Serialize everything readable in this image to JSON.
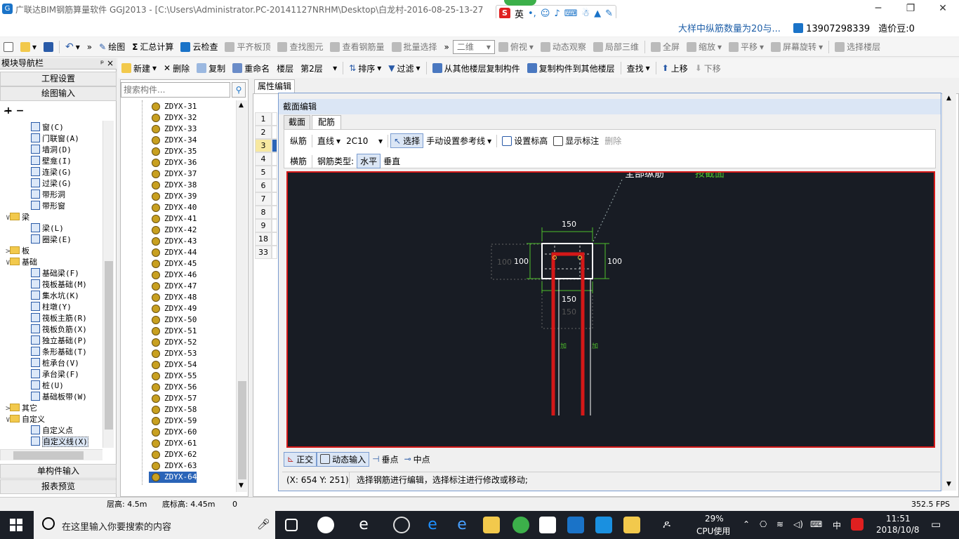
{
  "window": {
    "title": "广联达BIM钢筋算量软件 GGJ2013 - [C:\\Users\\Administrator.PC-20141127NRHM\\Desktop\\白龙村-2016-08-25-13-27",
    "ime_lang": "英",
    "notice": "大样中纵筋数量为20与...",
    "phone": "13907298339",
    "beans": "造价豆:0"
  },
  "toolbar1": {
    "draw": "绘图",
    "sum": "汇总计算",
    "cloud": "云检查",
    "flat": "平齐板顶",
    "find": "查找图元",
    "view_rebar": "查看钢筋量",
    "batch": "批量选择",
    "dim": "二维",
    "top_view": "俯视",
    "dynamic": "动态观察",
    "local3d": "局部三维",
    "full": "全屏",
    "zoom": "缩放",
    "pan": "平移",
    "rotate": "屏幕旋转",
    "floor_sel": "选择楼层"
  },
  "toolbar2": {
    "new": "新建",
    "delete": "删除",
    "copy": "复制",
    "rename": "重命名",
    "floor_label": "楼层",
    "floor_value": "第2层",
    "sort": "排序",
    "filter": "过滤",
    "copy_from": "从其他楼层复制构件",
    "copy_to": "复制构件到其他楼层",
    "find": "查找",
    "up": "上移",
    "down": "下移"
  },
  "left_panel": {
    "header": "模块导航栏",
    "pin": "ᵖ ×",
    "btn_project": "工程设置",
    "btn_draw": "绘图输入",
    "btn_single": "单构件输入",
    "btn_report": "报表预览",
    "tree": [
      {
        "label": "窗(C)",
        "indent": 3,
        "type": "item"
      },
      {
        "label": "门联窗(A)",
        "indent": 3,
        "type": "item"
      },
      {
        "label": "墙洞(D)",
        "indent": 3,
        "type": "item"
      },
      {
        "label": "壁龛(I)",
        "indent": 3,
        "type": "item"
      },
      {
        "label": "连梁(G)",
        "indent": 3,
        "type": "item"
      },
      {
        "label": "过梁(G)",
        "indent": 3,
        "type": "item"
      },
      {
        "label": "带形洞",
        "indent": 3,
        "type": "item"
      },
      {
        "label": "带形窗",
        "indent": 3,
        "type": "item"
      },
      {
        "label": "梁",
        "indent": 1,
        "type": "folder",
        "exp": "∨"
      },
      {
        "label": "梁(L)",
        "indent": 3,
        "type": "item"
      },
      {
        "label": "圈梁(E)",
        "indent": 3,
        "type": "item"
      },
      {
        "label": "板",
        "indent": 1,
        "type": "folder",
        "exp": ">"
      },
      {
        "label": "基础",
        "indent": 1,
        "type": "folder",
        "exp": "∨"
      },
      {
        "label": "基础梁(F)",
        "indent": 3,
        "type": "item"
      },
      {
        "label": "筏板基础(M)",
        "indent": 3,
        "type": "item"
      },
      {
        "label": "集水坑(K)",
        "indent": 3,
        "type": "item"
      },
      {
        "label": "柱墩(Y)",
        "indent": 3,
        "type": "item"
      },
      {
        "label": "筏板主筋(R)",
        "indent": 3,
        "type": "item"
      },
      {
        "label": "筏板负筋(X)",
        "indent": 3,
        "type": "item"
      },
      {
        "label": "独立基础(P)",
        "indent": 3,
        "type": "item"
      },
      {
        "label": "条形基础(T)",
        "indent": 3,
        "type": "item"
      },
      {
        "label": "桩承台(V)",
        "indent": 3,
        "type": "item"
      },
      {
        "label": "承台梁(F)",
        "indent": 3,
        "type": "item"
      },
      {
        "label": "桩(U)",
        "indent": 3,
        "type": "item"
      },
      {
        "label": "基础板带(W)",
        "indent": 3,
        "type": "item"
      },
      {
        "label": "其它",
        "indent": 1,
        "type": "folder",
        "exp": ">"
      },
      {
        "label": "自定义",
        "indent": 1,
        "type": "folder",
        "exp": "∨"
      },
      {
        "label": "自定义点",
        "indent": 3,
        "type": "item"
      },
      {
        "label": "自定义线(X)",
        "indent": 3,
        "type": "item",
        "selected": true
      }
    ]
  },
  "components": {
    "search_placeholder": "搜索构件...",
    "items": [
      "ZDYX-31",
      "ZDYX-32",
      "ZDYX-33",
      "ZDYX-34",
      "ZDYX-35",
      "ZDYX-36",
      "ZDYX-37",
      "ZDYX-38",
      "ZDYX-39",
      "ZDYX-40",
      "ZDYX-41",
      "ZDYX-42",
      "ZDYX-43",
      "ZDYX-44",
      "ZDYX-45",
      "ZDYX-46",
      "ZDYX-47",
      "ZDYX-48",
      "ZDYX-49",
      "ZDYX-50",
      "ZDYX-51",
      "ZDYX-52",
      "ZDYX-53",
      "ZDYX-54",
      "ZDYX-55",
      "ZDYX-56",
      "ZDYX-57",
      "ZDYX-58",
      "ZDYX-59",
      "ZDYX-60",
      "ZDYX-61",
      "ZDYX-62",
      "ZDYX-63",
      "ZDYX-64"
    ],
    "selected": "ZDYX-64"
  },
  "properties": {
    "tab": "属性编辑",
    "rows": [
      "1",
      "2",
      "3",
      "4",
      "5",
      "6",
      "7",
      "8",
      "9",
      "18",
      "33"
    ],
    "selected_row": "3"
  },
  "dialog": {
    "title": "截面编辑",
    "tab_section": "截面",
    "tab_rebar": "配筋",
    "long_rebar": "纵筋",
    "line_type": "直线",
    "rebar_spec": "2C10",
    "select": "选择",
    "manual_ref": "手动设置参考线",
    "set_elev": "设置标高",
    "show_dims": "显示标注",
    "delete": "删除",
    "stirrup": "横筋",
    "rebar_type_label": "钢筋类型:",
    "horizontal": "水平",
    "vertical": "垂直",
    "ortho": "正交",
    "dyn_input": "动态输入",
    "perp": "垂点",
    "mid": "中点",
    "coords": "(X: 654 Y: 251)",
    "hint": "选择钢筋进行编辑，选择标注进行修改或移动;"
  },
  "canvas": {
    "label_white": "全部纵筋",
    "label_green": "按截面",
    "dim_top": "150",
    "dim_left": "100",
    "dim_right": "100",
    "dim_left_ghost": "100",
    "dim_bottom": "150",
    "dim_bottom_ghost": "150",
    "rebar_mark": "加"
  },
  "status": {
    "floor_height": "层高: 4.5m",
    "base_elev": "底标高: 4.45m",
    "zero": "0",
    "fps": "352.5 FPS"
  },
  "taskbar": {
    "search": "在这里输入你要搜索的内容",
    "cpu_pct": "29%",
    "cpu_label": "CPU使用",
    "lang": "中",
    "time": "11:51",
    "date": "2018/10/8"
  },
  "colors": {
    "canvas_bg": "#181c24",
    "rebar": "#d41818",
    "dimension": "#4ec02c",
    "selection": "#2a64b8"
  }
}
